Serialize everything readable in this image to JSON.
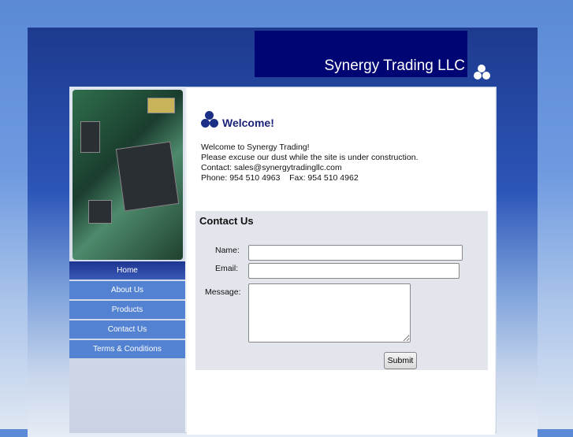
{
  "header": {
    "title": "Synergy Trading LLC"
  },
  "nav": {
    "items": [
      {
        "label": "Home"
      },
      {
        "label": "About Us"
      },
      {
        "label": "Products"
      },
      {
        "label": "Contact Us"
      },
      {
        "label": "Terms & Conditions"
      }
    ]
  },
  "welcome": {
    "title": "Welcome!",
    "lines": [
      "Welcome to Synergy Trading!",
      "Please excuse our dust while the site is under construction.",
      "Contact: sales@synergytradingllc.com",
      "Phone: 954 510 4963    Fax: 954 510 4962"
    ]
  },
  "contact": {
    "title": "Contact Us",
    "name_label": "Name:",
    "email_label": "Email:",
    "message_label": "Message:",
    "name_value": "",
    "email_value": "",
    "message_value": "",
    "submit_label": "Submit"
  },
  "colors": {
    "banner": "#000574",
    "nav": "#5382d2",
    "nav_active": "#1d3590",
    "heading": "#1c2378"
  }
}
